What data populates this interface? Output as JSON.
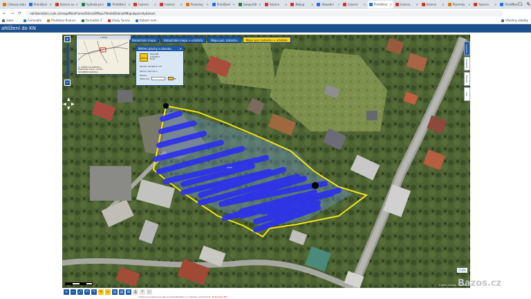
{
  "browser": {
    "tabs": [
      {
        "label": "Celkový zob",
        "color": "#e37400"
      },
      {
        "label": "Prohlížení",
        "color": "#1a73e8"
      },
      {
        "label": "Inzerce se",
        "color": "#d93025"
      },
      {
        "label": "Vyhledá po",
        "color": "#188038"
      },
      {
        "label": "Prohlížení",
        "color": "#1a73e8"
      },
      {
        "label": "Inzerce",
        "color": "#d93025"
      },
      {
        "label": "Inzerce",
        "color": "#d93025"
      },
      {
        "label": "Pozemky",
        "color": "#e37400"
      },
      {
        "label": "Prohlížení",
        "color": "#1a73e8"
      },
      {
        "label": "Geoportál",
        "color": "#188038"
      },
      {
        "label": "Inzerce",
        "color": "#d93025"
      },
      {
        "label": "Nákup",
        "color": "#d93025"
      },
      {
        "label": "Stavební",
        "color": "#1a73e8"
      },
      {
        "label": "Inzerce",
        "color": "#d93025"
      },
      {
        "label": "Prohlížení",
        "color": "#1a73e8",
        "active": true
      },
      {
        "label": "Inzerce",
        "color": "#d93025"
      },
      {
        "label": "Inzerce",
        "color": "#d93025"
      },
      {
        "label": "Pozemky",
        "color": "#e37400"
      },
      {
        "label": "Inzerce",
        "color": "#d93025"
      },
      {
        "label": "Prohlížení",
        "color": "#1a73e8"
      }
    ],
    "new_tab": "+",
    "window_controls": [
      "–",
      "□",
      "✕"
    ],
    "nav": {
      "back": "←",
      "forward": "→",
      "reload": "⟳"
    },
    "url": "nahlizenidokn.cuzk.cz/mapaMainFrame/ZobrazitMapu?hledatZobrazitMapu&parcely&zoom",
    "bookmarks": [
      "autor, ...",
      "Formuláře",
      "Prohlížení finance",
      "Formuláře 2",
      "Úřady Turnov",
      "Katastr nem..."
    ],
    "bookmarks_right": "Všechny záložky"
  },
  "site": {
    "title": "ahlížení do KN"
  },
  "map": {
    "tabs": [
      "Katastrální mapa",
      "Katastrální mapa + ortofoto",
      "Mapa poz. katastru",
      "Mapa poz. katastru + ortofoto"
    ],
    "selected_tab": 3,
    "overview_header": "1:5000",
    "overview_lines": [
      "K. ÚZEMÍ OK PARCELA",
      "PARCELNÍ ČÍSLO 1234/5",
      "STAVEBNÍ PARCELA"
    ],
    "measure_panel": {
      "title": "Měření plochy a obvodu",
      "close": "✕",
      "icon_label": "Oblast",
      "options": [
        "Zobrazit",
        "průběžné",
        "body"
      ],
      "area": "Plocha: 18 064,07 m²",
      "perimeter": "Obvod: 547,32 m",
      "color_label": "Plocha",
      "width_label": "Šířka (m):",
      "dropdown": "▾"
    },
    "right_tabs": [
      "Legenda",
      "Vyhledat",
      "Parcely",
      "Info"
    ],
    "parcel_label": "1234",
    "copyright": "© ČÚZK, Ortofoto © ČÚZK",
    "brand": "ČÚZK",
    "nav_buttons": [
      "+",
      "−"
    ],
    "pan": [
      "▲",
      "◀",
      "▶",
      "▼"
    ]
  },
  "toolbar": [
    "+",
    "−",
    "⤢",
    "↶",
    "↷",
    "✎",
    "⌕",
    "◎",
    "▤",
    "⊞",
    "⎙",
    "?",
    "ⓘ"
  ],
  "footer": {
    "text": "Služba je poskytována jako součást Nahlížení do katastru nemovitostí.",
    "link": "Podmínky užití"
  },
  "watermark": "Bazos.cz",
  "colors": {
    "header_blue": "#1d4f8c",
    "accent_blue": "#1e5aa8",
    "parcel_outline": "#f5e51a",
    "stripe_blue": "#2a2ff0"
  }
}
